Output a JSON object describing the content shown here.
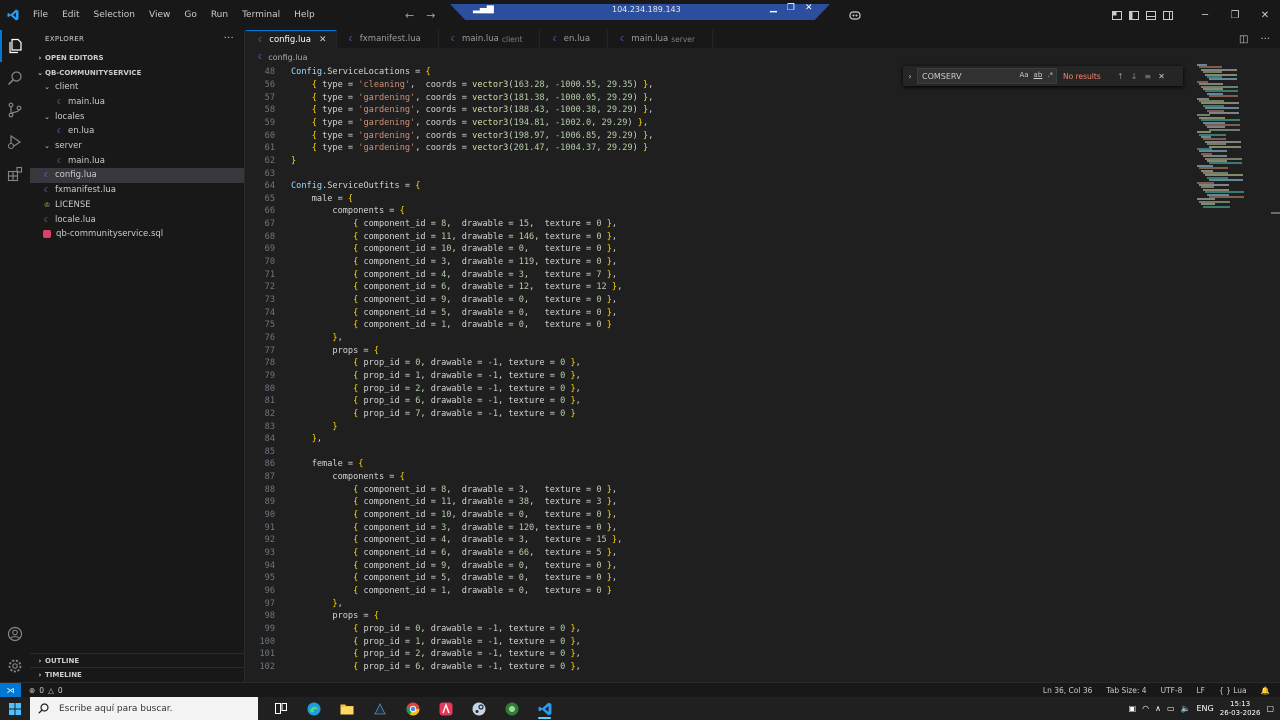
{
  "titlebar": {
    "menu": [
      "File",
      "Edit",
      "Selection",
      "View",
      "Go",
      "Run",
      "Terminal",
      "Help"
    ],
    "remote_ip": "104.234.189.143"
  },
  "sidebar": {
    "title": "EXPLORER",
    "open_editors": "OPEN EDITORS",
    "project": "QB-COMMUNITYSERVICE",
    "tree": [
      {
        "label": "client",
        "type": "folder",
        "indent": 1
      },
      {
        "label": "main.lua",
        "type": "lua",
        "indent": 2
      },
      {
        "label": "locales",
        "type": "folder",
        "indent": 1
      },
      {
        "label": "en.lua",
        "type": "lua",
        "indent": 2
      },
      {
        "label": "server",
        "type": "folder",
        "indent": 1
      },
      {
        "label": "main.lua",
        "type": "lua",
        "indent": 2
      },
      {
        "label": "config.lua",
        "type": "lua",
        "indent": 1,
        "selected": true
      },
      {
        "label": "fxmanifest.lua",
        "type": "lua",
        "indent": 1
      },
      {
        "label": "LICENSE",
        "type": "license",
        "indent": 1
      },
      {
        "label": "locale.lua",
        "type": "lua",
        "indent": 1
      },
      {
        "label": "qb-communityservice.sql",
        "type": "sql",
        "indent": 1
      }
    ],
    "outline": "OUTLINE",
    "timeline": "TIMELINE"
  },
  "tabs": [
    {
      "label": "config.lua",
      "desc": "",
      "active": true
    },
    {
      "label": "fxmanifest.lua",
      "desc": "",
      "active": false
    },
    {
      "label": "main.lua",
      "desc": "client",
      "active": false
    },
    {
      "label": "en.lua",
      "desc": "",
      "active": false
    },
    {
      "label": "main.lua",
      "desc": "server",
      "active": false
    }
  ],
  "breadcrumb": "config.lua",
  "find": {
    "query": "COMSERV",
    "result": "No results",
    "opt_case": "Aa",
    "opt_word": "ab",
    "opt_regex": ".*"
  },
  "code": [
    {
      "n": "48",
      "t": "Config.ServiceLocations = {"
    },
    {
      "n": "56",
      "t": "    { type = 'cleaning',  coords = vector3(163.28, -1000.55, 29.35) },"
    },
    {
      "n": "57",
      "t": "    { type = 'gardening', coords = vector3(181.38, -1000.05, 29.29) },"
    },
    {
      "n": "58",
      "t": "    { type = 'gardening', coords = vector3(188.43, -1000.38, 29.29) },"
    },
    {
      "n": "59",
      "t": "    { type = 'gardening', coords = vector3(194.81, -1002.0, 29.29) },"
    },
    {
      "n": "60",
      "t": "    { type = 'gardening', coords = vector3(198.97, -1006.85, 29.29) },"
    },
    {
      "n": "61",
      "t": "    { type = 'gardening', coords = vector3(201.47, -1004.37, 29.29) }"
    },
    {
      "n": "62",
      "t": "}"
    },
    {
      "n": "63",
      "t": ""
    },
    {
      "n": "64",
      "t": "Config.ServiceOutfits = {"
    },
    {
      "n": "65",
      "t": "    male = {"
    },
    {
      "n": "66",
      "t": "        components = {"
    },
    {
      "n": "67",
      "t": "            { component_id = 8,  drawable = 15,  texture = 0 },"
    },
    {
      "n": "68",
      "t": "            { component_id = 11, drawable = 146, texture = 0 },"
    },
    {
      "n": "69",
      "t": "            { component_id = 10, drawable = 0,   texture = 0 },"
    },
    {
      "n": "70",
      "t": "            { component_id = 3,  drawable = 119, texture = 0 },"
    },
    {
      "n": "71",
      "t": "            { component_id = 4,  drawable = 3,   texture = 7 },"
    },
    {
      "n": "72",
      "t": "            { component_id = 6,  drawable = 12,  texture = 12 },"
    },
    {
      "n": "73",
      "t": "            { component_id = 9,  drawable = 0,   texture = 0 },"
    },
    {
      "n": "74",
      "t": "            { component_id = 5,  drawable = 0,   texture = 0 },"
    },
    {
      "n": "75",
      "t": "            { component_id = 1,  drawable = 0,   texture = 0 }"
    },
    {
      "n": "76",
      "t": "        },"
    },
    {
      "n": "77",
      "t": "        props = {"
    },
    {
      "n": "78",
      "t": "            { prop_id = 0, drawable = -1, texture = 0 },"
    },
    {
      "n": "79",
      "t": "            { prop_id = 1, drawable = -1, texture = 0 },"
    },
    {
      "n": "80",
      "t": "            { prop_id = 2, drawable = -1, texture = 0 },"
    },
    {
      "n": "81",
      "t": "            { prop_id = 6, drawable = -1, texture = 0 },"
    },
    {
      "n": "82",
      "t": "            { prop_id = 7, drawable = -1, texture = 0 }"
    },
    {
      "n": "83",
      "t": "        }"
    },
    {
      "n": "84",
      "t": "    },"
    },
    {
      "n": "85",
      "t": ""
    },
    {
      "n": "86",
      "t": "    female = {"
    },
    {
      "n": "87",
      "t": "        components = {"
    },
    {
      "n": "88",
      "t": "            { component_id = 8,  drawable = 3,   texture = 0 },"
    },
    {
      "n": "89",
      "t": "            { component_id = 11, drawable = 38,  texture = 3 },"
    },
    {
      "n": "90",
      "t": "            { component_id = 10, drawable = 0,   texture = 0 },"
    },
    {
      "n": "91",
      "t": "            { component_id = 3,  drawable = 120, texture = 0 },"
    },
    {
      "n": "92",
      "t": "            { component_id = 4,  drawable = 3,   texture = 15 },"
    },
    {
      "n": "93",
      "t": "            { component_id = 6,  drawable = 66,  texture = 5 },"
    },
    {
      "n": "94",
      "t": "            { component_id = 9,  drawable = 0,   texture = 0 },"
    },
    {
      "n": "95",
      "t": "            { component_id = 5,  drawable = 0,   texture = 0 },"
    },
    {
      "n": "96",
      "t": "            { component_id = 1,  drawable = 0,   texture = 0 }"
    },
    {
      "n": "97",
      "t": "        },"
    },
    {
      "n": "98",
      "t": "        props = {"
    },
    {
      "n": "99",
      "t": "            { prop_id = 0, drawable = -1, texture = 0 },"
    },
    {
      "n": "100",
      "t": "            { prop_id = 1, drawable = -1, texture = 0 },"
    },
    {
      "n": "101",
      "t": "            { prop_id = 2, drawable = -1, texture = 0 },"
    },
    {
      "n": "102",
      "t": "            { prop_id = 6, drawable = -1, texture = 0 },"
    }
  ],
  "status": {
    "problems": "0",
    "warnings": "0",
    "position": "Ln 36, Col 36",
    "tab_size": "Tab Size: 4",
    "encoding": "UTF-8",
    "eol": "LF",
    "language": "Lua"
  },
  "taskbar": {
    "search_placeholder": "Escribe aquí para buscar.",
    "lang": "ENG",
    "time": "15:13",
    "date": "26-03-2026"
  },
  "colors": {
    "accent": "#0078d4",
    "background": "#1f1f1f",
    "sidebar": "#181818"
  }
}
